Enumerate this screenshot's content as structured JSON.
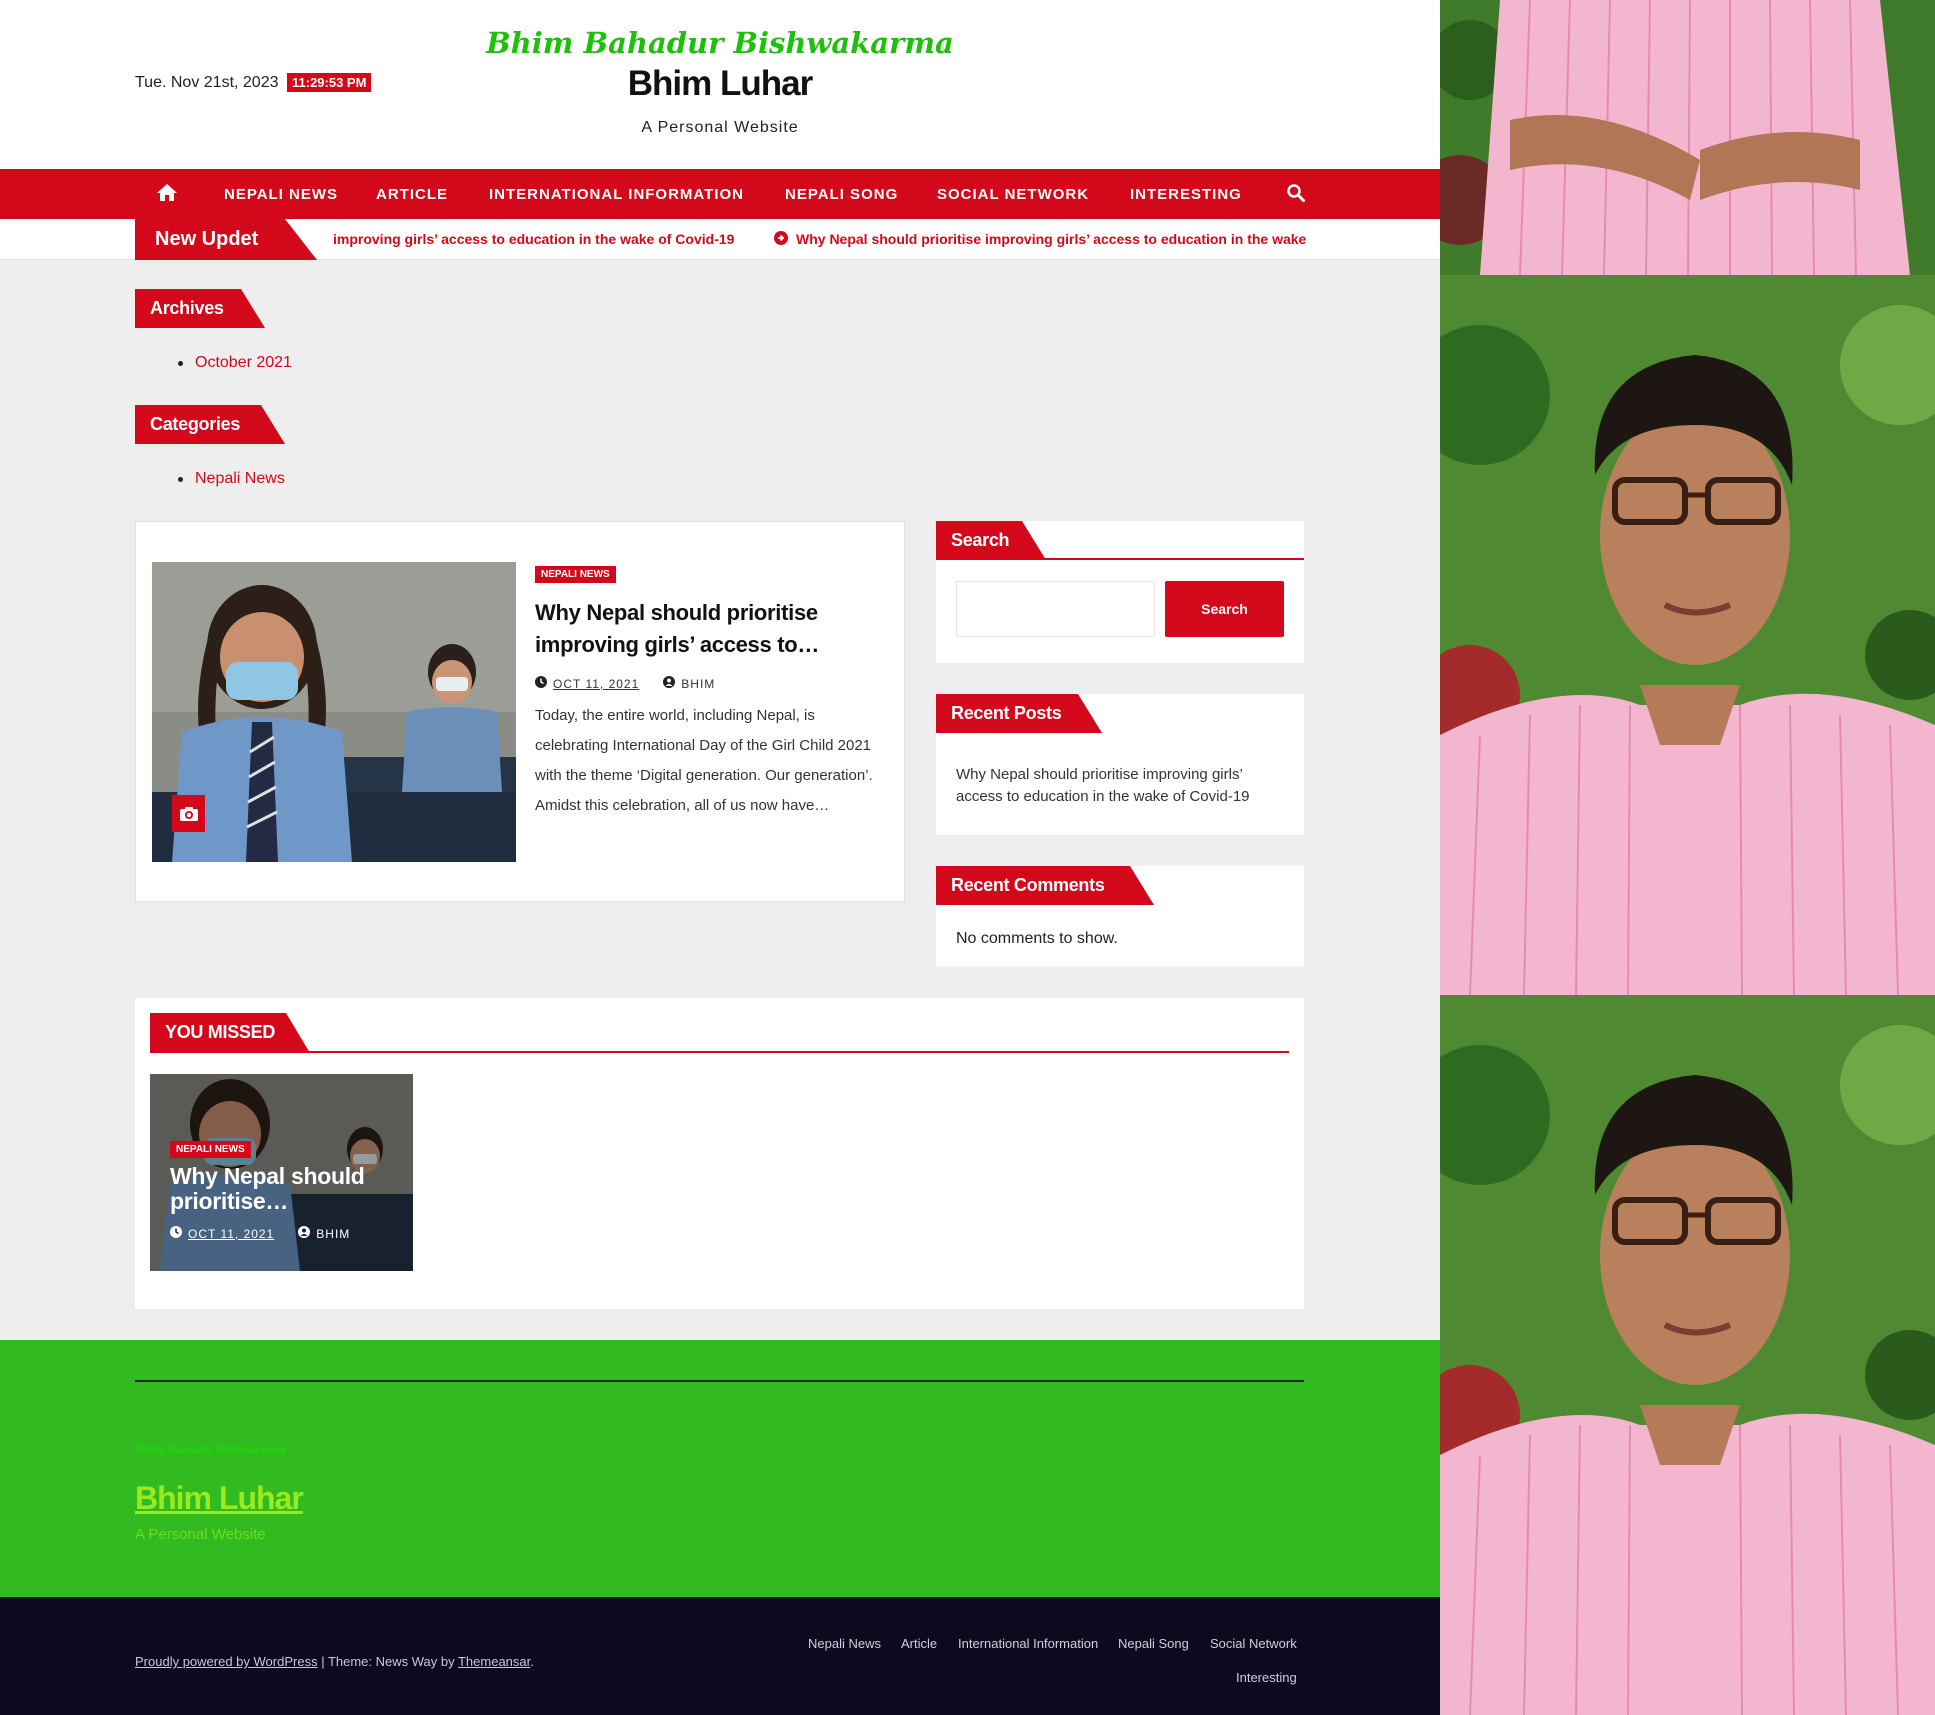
{
  "header": {
    "date": "Tue. Nov 21st, 2023",
    "time": "11:29:53 PM",
    "signature": "Bhim Bahadur Bishwakarma",
    "site_title": "Bhim Luhar",
    "tagline": "A Personal Website"
  },
  "nav": {
    "home_icon": "home-icon",
    "items": [
      "NEPALI NEWS",
      "ARTICLE",
      "INTERNATIONAL INFORMATION",
      "NEPALI SONG",
      "SOCIAL NETWORK",
      "INTERESTING"
    ],
    "search_icon": "search-icon"
  },
  "ticker": {
    "label": "New Updet",
    "text_partial": "improving girls’ access to education in the wake of Covid-19",
    "text_full": "Why Nepal should prioritise improving girls’ access to education in the wake"
  },
  "archives": {
    "title": "Archives",
    "items": [
      "October 2021"
    ]
  },
  "categories": {
    "title": "Categories",
    "items": [
      "Nepali News"
    ]
  },
  "post": {
    "category": "NEPALI NEWS",
    "title": "Why Nepal should prioritise improving girls’ access to…",
    "date": "OCT 11, 2021",
    "author": "BHIM",
    "excerpt": "Today, the entire world, including Nepal, is celebrating International Day of the Girl Child 2021 with the theme ‘Digital generation. Our generation’. Amidst this celebration, all of us now have…"
  },
  "sidebar": {
    "search": {
      "title": "Search",
      "button": "Search",
      "placeholder": ""
    },
    "recent_posts": {
      "title": "Recent Posts",
      "items": [
        "Why Nepal should prioritise improving girls’ access to education in the wake of Covid-19"
      ]
    },
    "recent_comments": {
      "title": "Recent Comments",
      "empty": "No comments to show."
    }
  },
  "you_missed": {
    "title": "YOU MISSED",
    "item": {
      "category": "NEPALI NEWS",
      "title": "Why Nepal should prioritise…",
      "date": "OCT 11, 2021",
      "author": "BHIM"
    }
  },
  "footer": {
    "signature": "Bhim Bahadur Bishwakarma",
    "site_title": "Bhim Luhar",
    "tagline": "A Personal Website",
    "powered": "Proudly powered by WordPress",
    "separator": " | Theme: News Way by ",
    "theme_author": "Themeansar",
    "end": ".",
    "nav": [
      "Nepali News",
      "Article",
      "International Information",
      "Nepali Song",
      "Social Network",
      "Interesting"
    ]
  },
  "colors": {
    "accent": "#d3091b",
    "footer_green": "#31bb20",
    "footer_dark": "#0b0a1f",
    "signature_green": "#1fbf0d"
  }
}
